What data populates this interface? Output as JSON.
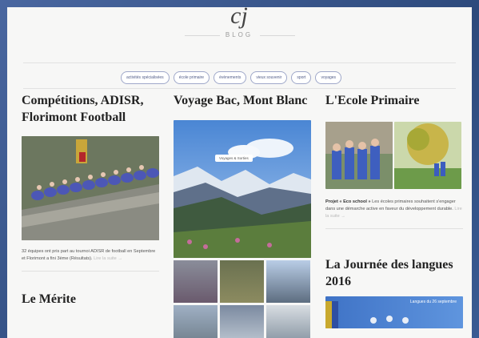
{
  "header": {
    "logo_glyph": "cj",
    "blog_label": "BLOG"
  },
  "tags": [
    "activités spécialisées",
    "école primaire",
    "évènements",
    "vieux souvenir",
    "sport",
    "voyages"
  ],
  "posts": {
    "col1": {
      "title": "Compétitions, ADISR, Florimont Football",
      "excerpt": "32 équipes ont pris part au tournoi ADISR de football en Septembre et Florimont a fini 3ème (Résultats).",
      "more": "Lire la suite →",
      "next_title": "Le Mérite"
    },
    "col2": {
      "title": "Voyage Bac, Mont Blanc",
      "image_badge": "Voyages & Sorties"
    },
    "col3": {
      "title": "L'Ecole Primaire",
      "excerpt_bold": "Projet « Eco school »",
      "excerpt": " Les écoles primaires souhaitent s'engager dans une démarche active en faveur du développement durable.",
      "more": "Lire la suite →",
      "next_title": "La Journée des langues 2016",
      "banner_text": "Langues du 26 septembre"
    }
  },
  "colors": {
    "frame": "#3c5a8e",
    "page": "#f7f7f6",
    "tag_border": "#9fa8c9",
    "title": "#222222"
  }
}
